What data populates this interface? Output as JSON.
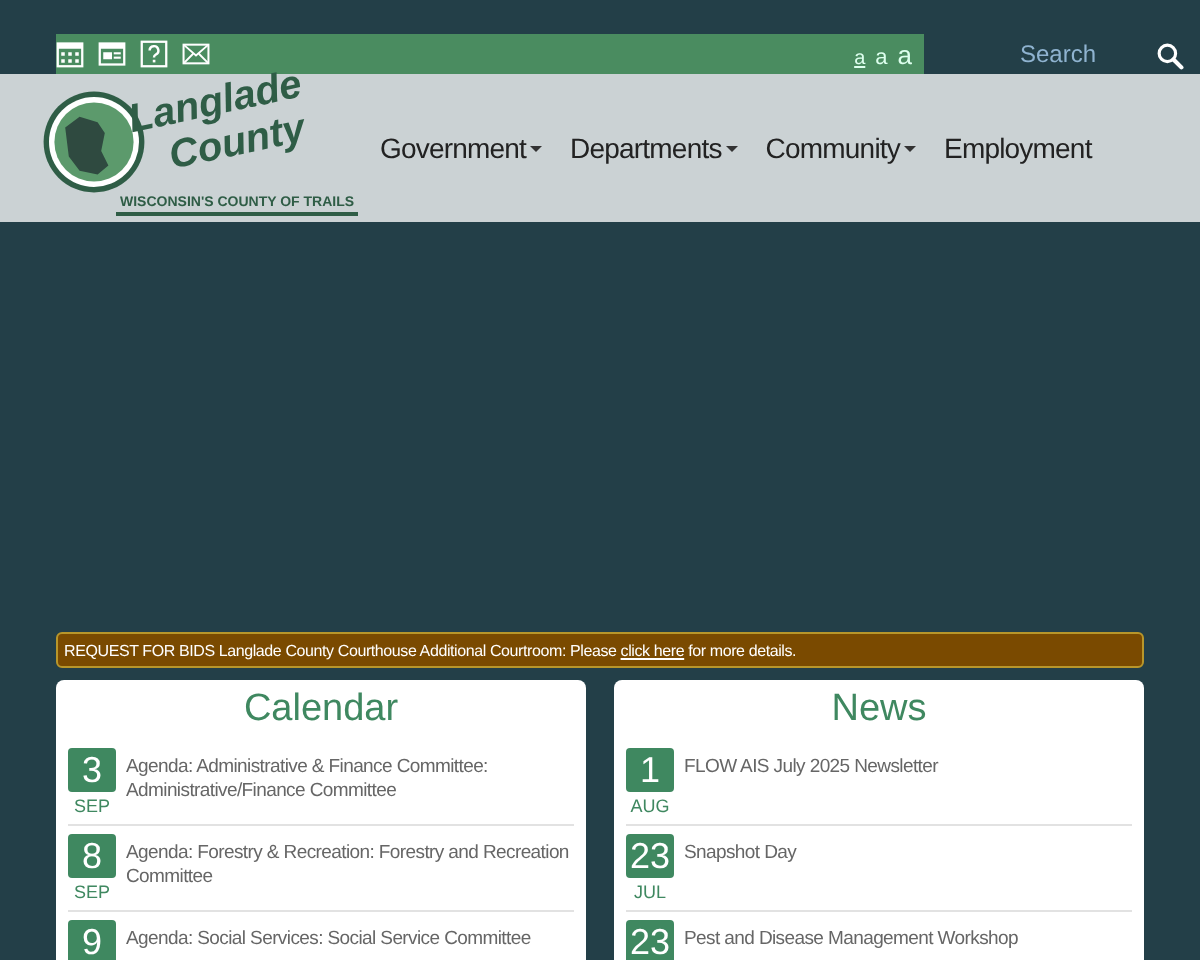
{
  "utility_bar": {
    "icons": [
      {
        "kind": "calendar"
      },
      {
        "kind": "card"
      },
      {
        "kind": "help"
      },
      {
        "kind": "mail"
      }
    ],
    "text_sizes": [
      {
        "label": "a",
        "selected": true
      },
      {
        "label": "a",
        "selected": false
      },
      {
        "label": "a",
        "selected": false
      }
    ],
    "search": {
      "label": "Search"
    }
  },
  "logo": {
    "name_line_1": "Langlade",
    "name_line_2": "County",
    "tagline": "WISCONSIN'S COUNTY OF TRAILS"
  },
  "nav": [
    {
      "label": "Government",
      "dropdown": true
    },
    {
      "label": "Departments",
      "dropdown": true
    },
    {
      "label": "Community",
      "dropdown": true
    },
    {
      "label": "Employment",
      "dropdown": false
    }
  ],
  "alert": {
    "text": "REQUEST FOR BIDS Langlade County Courthouse Additional Courtroom: Please",
    "link": "click here",
    "after": "for more details."
  },
  "calendar": {
    "title": "Calendar",
    "items": [
      {
        "day": "3",
        "month": "SEP",
        "title": "Agenda: Administrative & Finance Committee: Administrative/Finance Committee"
      },
      {
        "day": "8",
        "month": "SEP",
        "title": "Agenda: Forestry & Recreation: Forestry and Recreation Committee"
      },
      {
        "day": "9",
        "title": "Agenda: Social Services: Social Service Committee"
      }
    ]
  },
  "news": {
    "title": "News",
    "items": [
      {
        "day": "1",
        "month": "AUG",
        "title": "FLOW AIS July 2025 Newsletter"
      },
      {
        "day": "23",
        "month": "JUL",
        "title": "Snapshot Day"
      },
      {
        "day": "23",
        "title": "Pest and Disease Management Workshop"
      }
    ]
  }
}
